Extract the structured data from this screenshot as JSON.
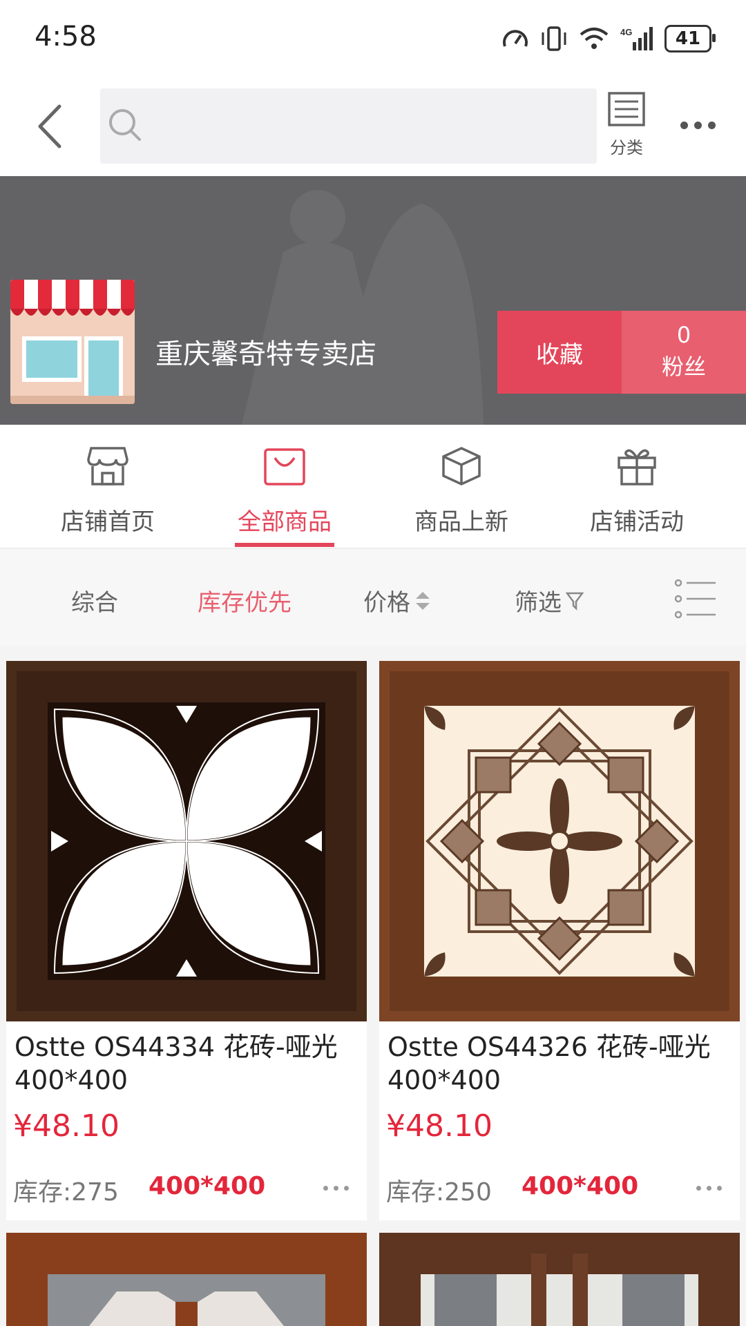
{
  "status_bar": {
    "time": "4:58",
    "battery": "41"
  },
  "nav": {
    "search_placeholder": "",
    "category_label": "分类"
  },
  "shop": {
    "name": "重庆馨奇特专卖店",
    "favorite_label": "收藏",
    "fans_count": "0",
    "fans_label": "粉丝"
  },
  "shop_tabs": [
    {
      "label": "店铺首页",
      "icon": "store-icon"
    },
    {
      "label": "全部商品",
      "icon": "shopping-bag-icon"
    },
    {
      "label": "商品上新",
      "icon": "box-icon"
    },
    {
      "label": "店铺活动",
      "icon": "gift-icon"
    }
  ],
  "active_shop_tab": "全部商品",
  "sort_options": {
    "comprehensive": "综合",
    "stock_first": "库存优先",
    "price": "价格",
    "filter": "筛选"
  },
  "products": [
    {
      "name": "Ostte OS44334 花砖-哑光 400*400",
      "price": "¥48.10",
      "stock": "库存:275",
      "spec": "400*400"
    },
    {
      "name": "Ostte OS44326 花砖-哑光 400*400",
      "price": "¥48.10",
      "stock": "库存:250",
      "spec": "400*400"
    }
  ],
  "colors": {
    "accent": "#e3465a",
    "price": "#e3263b",
    "banner": "#636366"
  }
}
